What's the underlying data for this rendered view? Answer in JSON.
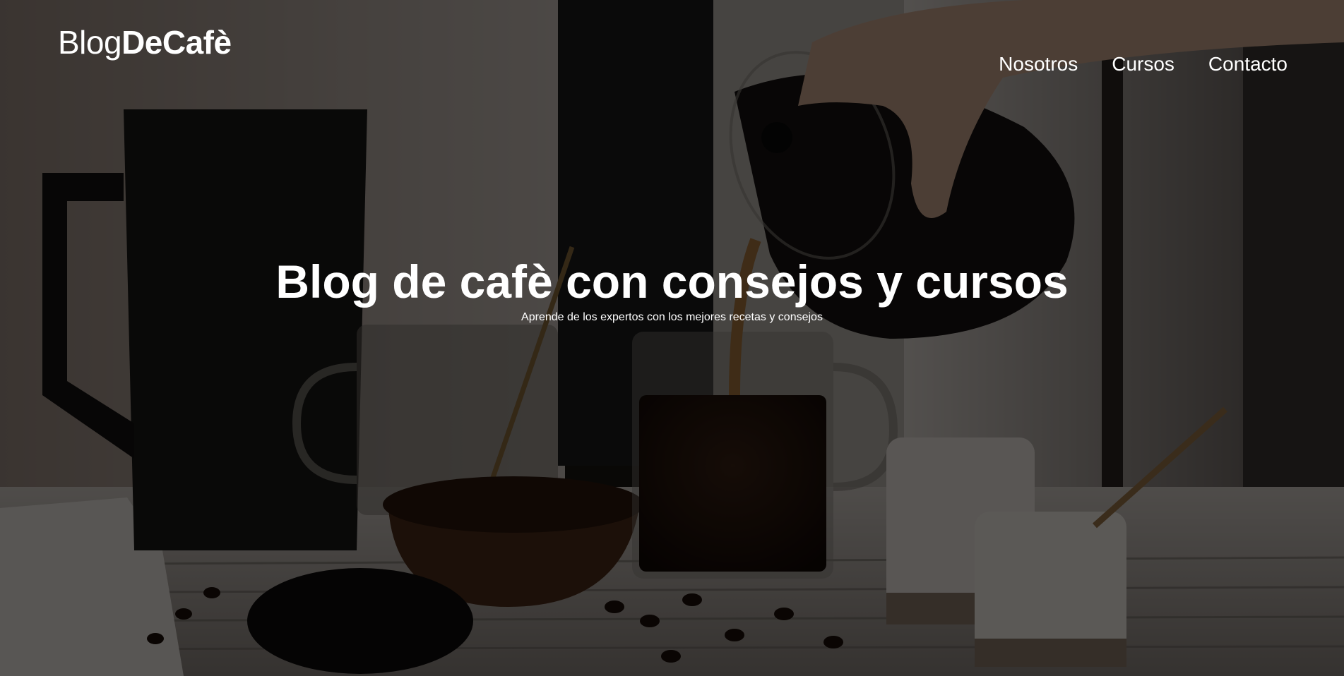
{
  "header": {
    "logo": {
      "light": "Blog",
      "bold": "DeCafè"
    },
    "nav": [
      {
        "label": "Nosotros"
      },
      {
        "label": "Cursos"
      },
      {
        "label": "Contacto"
      }
    ]
  },
  "hero": {
    "title": "Blog de cafè con consejos y cursos",
    "subtitle": "Aprende de los expertos con los mejores recetas y consejos"
  }
}
